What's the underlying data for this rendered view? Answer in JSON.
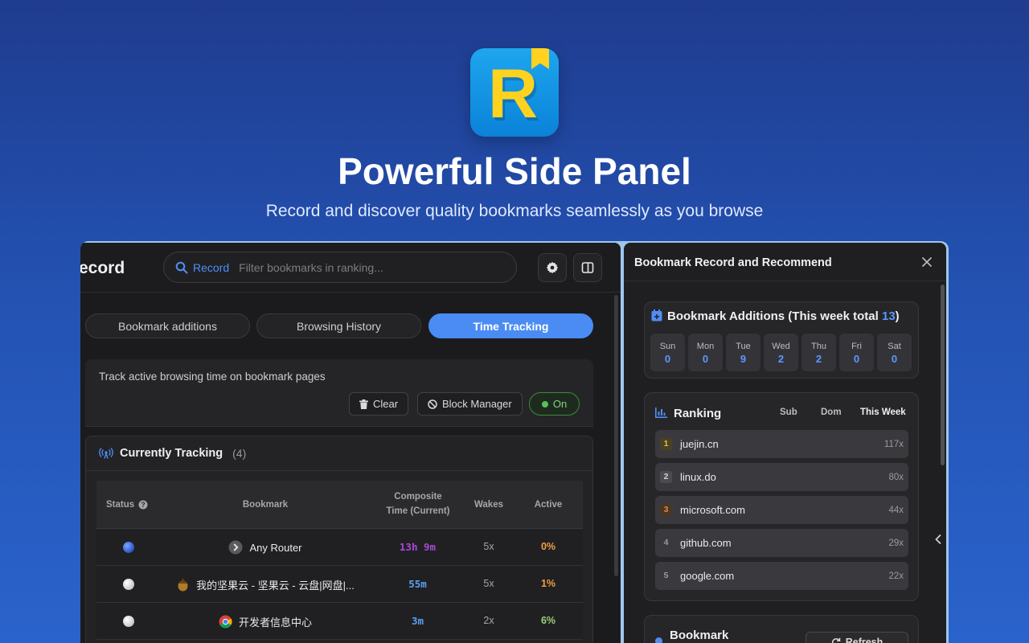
{
  "hero": {
    "title": "Powerful Side Panel",
    "subtitle": "Record and discover quality bookmarks seamlessly as you browse",
    "icon_letter": "R"
  },
  "left": {
    "brand": "ecord",
    "search": {
      "label": "Record",
      "placeholder": "Filter bookmarks in ranking..."
    },
    "tabs": [
      "Bookmark additions",
      "Browsing History",
      "Time Tracking"
    ],
    "active_tab": "Time Tracking",
    "track": {
      "description": "Track active browsing time on bookmark pages",
      "clear_label": "Clear",
      "block_label": "Block Manager",
      "on_label": "On"
    },
    "currently_tracking": {
      "title": "Currently Tracking",
      "count": "(4)",
      "headers": {
        "status": "Status",
        "bookmark": "Bookmark",
        "composite": "Composite",
        "composite_sub": "Time (Current)",
        "wakes": "Wakes",
        "active": "Active"
      },
      "rows": [
        {
          "status": "blue",
          "icon": "arrow-circle-icon",
          "name": "Any Router",
          "time": "13h 9m",
          "time_color": "#a64ad6",
          "wakes": "5x",
          "active": "0%",
          "active_color": "#f0a040"
        },
        {
          "status": "white",
          "icon": "nut-icon",
          "name": "我的坚果云 - 坚果云 - 云盘|网盘|...",
          "time": "55m",
          "time_color": "#5aa0f0",
          "wakes": "5x",
          "active": "1%",
          "active_color": "#f0a040"
        },
        {
          "status": "white",
          "icon": "chrome-icon",
          "name": "开发者信息中心",
          "time": "3m",
          "time_color": "#5aa0f0",
          "wakes": "2x",
          "active": "6%",
          "active_color": "#9ad07a"
        }
      ]
    }
  },
  "right": {
    "title": "Bookmark Record and Recommend",
    "additions": {
      "title": "Bookmark Additions (This week total ",
      "total": "13",
      "title_end": ")",
      "days": [
        {
          "name": "Sun",
          "value": "0"
        },
        {
          "name": "Mon",
          "value": "0"
        },
        {
          "name": "Tue",
          "value": "9"
        },
        {
          "name": "Wed",
          "value": "2"
        },
        {
          "name": "Thu",
          "value": "2"
        },
        {
          "name": "Fri",
          "value": "0"
        },
        {
          "name": "Sat",
          "value": "0"
        }
      ]
    },
    "ranking": {
      "title": "Ranking",
      "cols": [
        "Sub",
        "Dom",
        "This Week"
      ],
      "items": [
        {
          "rank": "1",
          "name": "juejin.cn",
          "count": "117x",
          "color": "#e8b84a"
        },
        {
          "rank": "2",
          "name": "linux.do",
          "count": "80x",
          "color": "#bfbfc4"
        },
        {
          "rank": "3",
          "name": "microsoft.com",
          "count": "44x",
          "color": "#d98a4a"
        },
        {
          "rank": "4",
          "name": "github.com",
          "count": "29x",
          "color": "#9a9aa0"
        },
        {
          "rank": "5",
          "name": "google.com",
          "count": "22x",
          "color": "#9a9aa0"
        }
      ]
    },
    "recommend": {
      "title": "Bookmark",
      "refresh_label": "Refresh"
    }
  }
}
